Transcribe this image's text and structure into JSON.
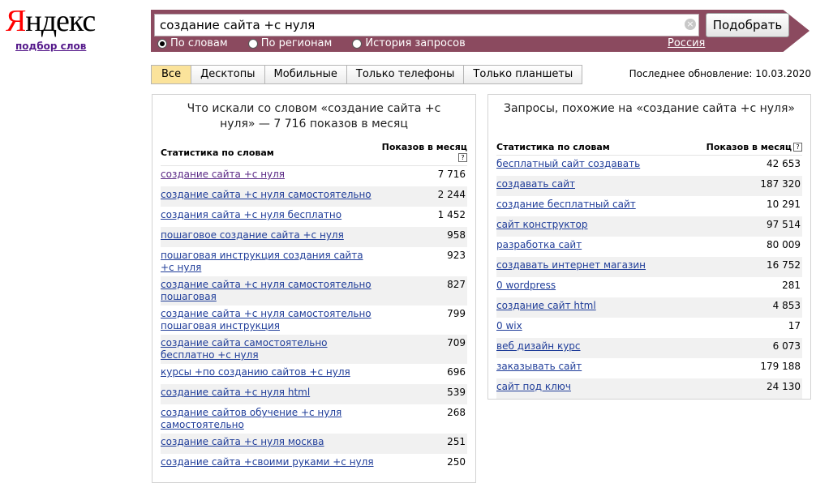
{
  "logo": {
    "first": "Я",
    "rest": "ндекс"
  },
  "service_link": "подбор слов",
  "search": {
    "query": "создание сайта +с нуля",
    "clear_glyph": "×",
    "submit_label": "Подобрать",
    "region": "Россия"
  },
  "modes": [
    {
      "label": "По словам",
      "checked": true
    },
    {
      "label": "По регионам",
      "checked": false
    },
    {
      "label": "История запросов",
      "checked": false
    }
  ],
  "tabs": [
    {
      "label": "Все",
      "active": true
    },
    {
      "label": "Десктопы",
      "active": false
    },
    {
      "label": "Мобильные",
      "active": false
    },
    {
      "label": "Только телефоны",
      "active": false
    },
    {
      "label": "Только планшеты",
      "active": false
    }
  ],
  "last_update": "Последнее обновление: 10.03.2020",
  "left": {
    "title": "Что искали со словом «создание сайта +с нуля» — 7 716 показов в месяц",
    "col_query": "Статистика по словам",
    "col_count": "Показов в месяц",
    "help": "?",
    "rows": [
      {
        "q": "создание сайта +с нуля",
        "n": "7 716"
      },
      {
        "q": "создание сайта +с нуля самостоятельно",
        "n": "2 244"
      },
      {
        "q": "создания сайта +с нуля бесплатно",
        "n": "1 452"
      },
      {
        "q": "пошаговое создание сайта +с нуля",
        "n": "958"
      },
      {
        "q": "пошаговая инструкция создания сайта +с нуля",
        "n": "923"
      },
      {
        "q": "создание сайта +с нуля самостоятельно пошаговая",
        "n": "827"
      },
      {
        "q": "создание сайта +с нуля самостоятельно пошаговая инструкция",
        "n": "799"
      },
      {
        "q": "создание сайта самостоятельно бесплатно +с нуля",
        "n": "709"
      },
      {
        "q": "курсы +по созданию сайтов +с нуля",
        "n": "696"
      },
      {
        "q": "создание сайта +с нуля html",
        "n": "539"
      },
      {
        "q": "создание сайтов обучение +с нуля самостоятельно",
        "n": "268"
      },
      {
        "q": "создание сайта +с нуля москва",
        "n": "251"
      },
      {
        "q": "создание сайта +своими руками +с нуля",
        "n": "250"
      }
    ]
  },
  "right": {
    "title": "Запросы, похожие на «создание сайта +с нуля»",
    "col_query": "Статистика по словам",
    "col_count": "Показов в месяц",
    "help": "?",
    "rows": [
      {
        "q": "бесплатный сайт создавать",
        "n": "42 653"
      },
      {
        "q": "создавать сайт",
        "n": "187 320"
      },
      {
        "q": "создание бесплатный сайт",
        "n": "10 291"
      },
      {
        "q": "сайт конструктор",
        "n": "97 514"
      },
      {
        "q": "разработка сайт",
        "n": "80 009"
      },
      {
        "q": "создавать интернет магазин",
        "n": "16 752"
      },
      {
        "q": "0 wordpress",
        "n": "281"
      },
      {
        "q": "создание сайт html",
        "n": "4 853"
      },
      {
        "q": "0 wix",
        "n": "17"
      },
      {
        "q": "веб дизайн курс",
        "n": "6 073"
      },
      {
        "q": "заказывать сайт",
        "n": "179 188"
      },
      {
        "q": "сайт под ключ",
        "n": "24 130"
      }
    ]
  }
}
